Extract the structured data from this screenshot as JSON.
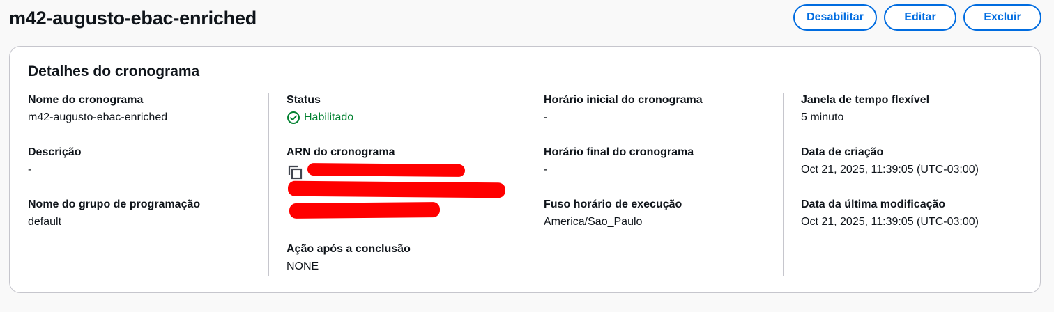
{
  "header": {
    "title": "m42-augusto-ebac-enriched",
    "buttons": {
      "disable": "Desabilitar",
      "edit": "Editar",
      "delete": "Excluir"
    }
  },
  "details": {
    "title": "Detalhes do cronograma",
    "schedule_name": {
      "label": "Nome do cronograma",
      "value": "m42-augusto-ebac-enriched"
    },
    "description": {
      "label": "Descrição",
      "value": "-"
    },
    "group_name": {
      "label": "Nome do grupo de programação",
      "value": "default"
    },
    "status": {
      "label": "Status",
      "value": "Habilitado",
      "icon": "check-circle-icon",
      "color": "#00802f"
    },
    "arn": {
      "label": "ARN do cronograma",
      "icon": "copy-icon"
    },
    "action_after": {
      "label": "Ação após a conclusão",
      "value": "NONE"
    },
    "start_time": {
      "label": "Horário inicial do cronograma",
      "value": "-"
    },
    "end_time": {
      "label": "Horário final do cronograma",
      "value": "-"
    },
    "timezone": {
      "label": "Fuso horário de execução",
      "value": "America/Sao_Paulo"
    },
    "flex_window": {
      "label": "Janela de tempo flexível",
      "value": "5 minuto"
    },
    "created": {
      "label": "Data de criação",
      "value": "Oct 21, 2025, 11:39:05 (UTC-03:00)"
    },
    "modified": {
      "label": "Data da última modificação",
      "value": "Oct 21, 2025, 11:39:05 (UTC-03:00)"
    }
  },
  "colors": {
    "accent": "#006ce0",
    "success": "#00802f",
    "redaction": "#ff0000",
    "divider": "#c6c6cd"
  }
}
